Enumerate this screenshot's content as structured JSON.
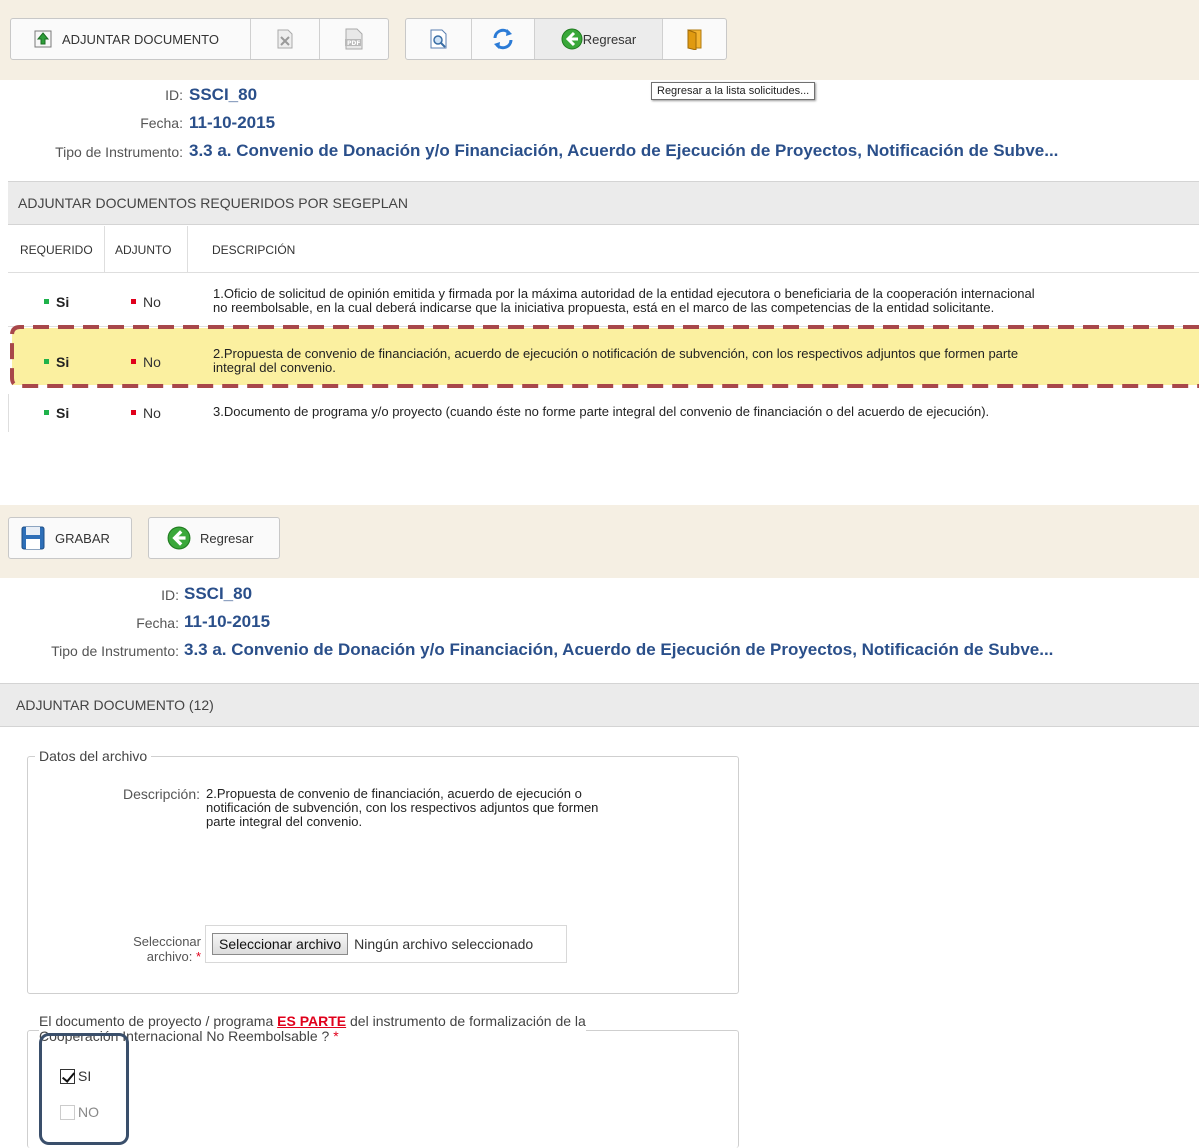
{
  "top": {
    "toolbar": {
      "attach_label": "ADJUNTAR DOCUMENTO",
      "back_label": "Regresar",
      "tooltip": "Regresar a la lista solicitudes..."
    },
    "info": {
      "id_label": "ID:",
      "id_value": "SSCI_80",
      "date_label": "Fecha:",
      "date_value": "11-10-2015",
      "type_label": "Tipo de Instrumento:",
      "type_value": "3.3 a. Convenio de Donación y/o Financiación, Acuerdo de Ejecución de Proyectos, Notificación de Subve..."
    },
    "section_title": "ADJUNTAR DOCUMENTOS REQUERIDOS POR SEGEPLAN",
    "columns": [
      "REQUERIDO",
      "ADJUNTO",
      "DESCRIPCIÓN"
    ],
    "rows": [
      {
        "required": "Si",
        "attached": "No",
        "line1": "1.Oficio de solicitud de opinión emitida y firmada por la máxima autoridad de la entidad ejecutora o beneficiaria de la cooperación internacional",
        "line2": "no reembolsable, en la cual deberá indicarse que la iniciativa propuesta, está en el marco de las competencias de la entidad solicitante."
      },
      {
        "required": "Si",
        "attached": "No",
        "line1": "2.Propuesta de convenio de financiación, acuerdo de ejecución o notificación de subvención, con los respectivos adjuntos que formen parte",
        "line2": "integral del convenio."
      },
      {
        "required": "Si",
        "attached": "No",
        "line1": "3.Documento de programa y/o proyecto (cuando éste no forme parte integral del convenio de financiación o del acuerdo de ejecución).",
        "line2": ""
      }
    ]
  },
  "bottom": {
    "toolbar": {
      "save_label": "GRABAR",
      "back_label": "Regresar"
    },
    "info": {
      "id_label": "ID:",
      "id_value": "SSCI_80",
      "date_label": "Fecha:",
      "date_value": "11-10-2015",
      "type_label": "Tipo de Instrumento:",
      "type_value": "3.3 a. Convenio de Donación y/o Financiación, Acuerdo de Ejecución de Proyectos, Notificación de Subve..."
    },
    "section_title": "ADJUNTAR DOCUMENTO (12)",
    "fieldset_legend": "Datos del archivo",
    "description_label": "Descripción:",
    "description_lines": [
      "2.Propuesta de convenio de financiación, acuerdo de ejecución o",
      "notificación de subvención, con los respectivos adjuntos que formen",
      "parte integral del convenio."
    ],
    "select_label_1": "Seleccionar",
    "select_label_2": "archivo:",
    "required_mark": "*",
    "file_button": "Seleccionar archivo",
    "file_status": "Ningún archivo seleccionado",
    "question_pre": "El documento de proyecto / programa ",
    "question_emph": "ES PARTE",
    "question_post": " del instrumento de formalización de la",
    "question_line2": "Cooperación Internacional No Reembolsable ?",
    "option_si": "SI",
    "option_no": "NO"
  },
  "colors": {
    "accent_blue": "#2a4f8a",
    "required_red": "#e0001b",
    "ok_green": "#1fb24a",
    "highlight": "#fbf0a0",
    "dash": "#a8474a",
    "annotation_box": "#3a4f6b"
  }
}
